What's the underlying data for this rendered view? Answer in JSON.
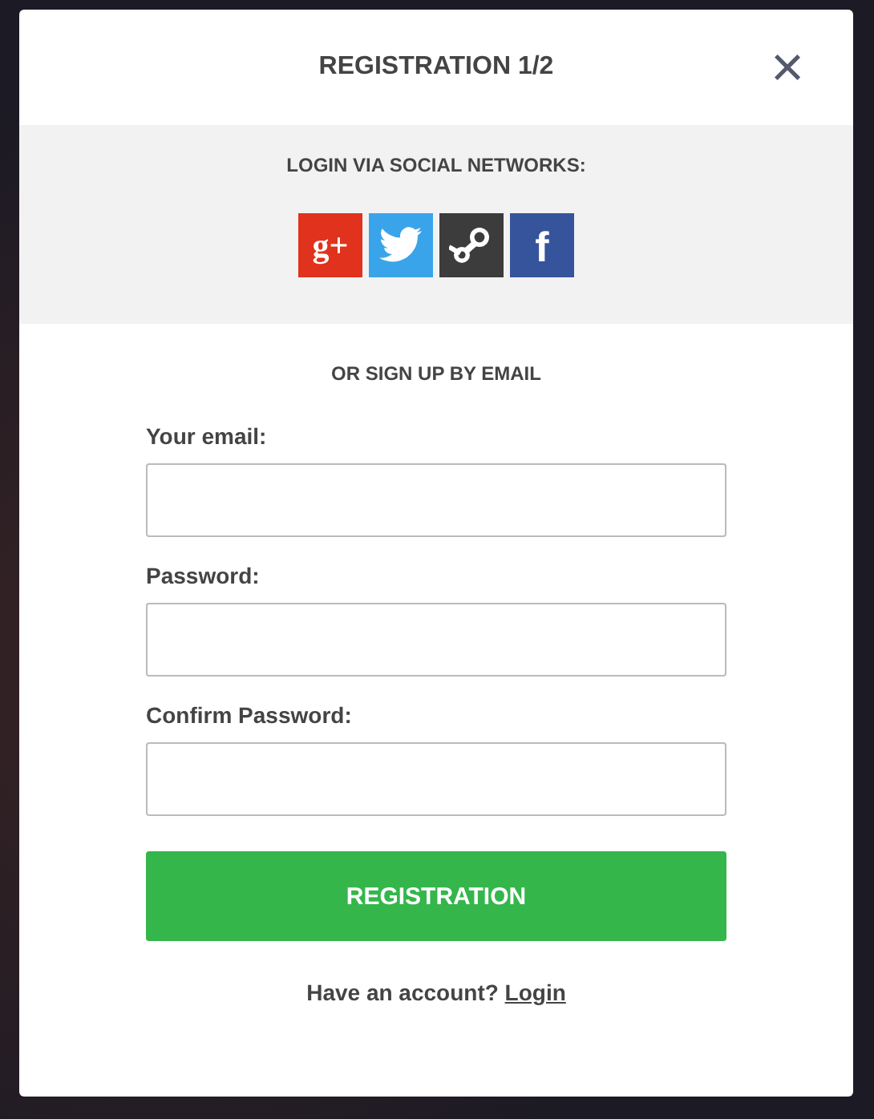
{
  "modal": {
    "title": "REGISTRATION 1/2",
    "close": "×"
  },
  "social": {
    "heading": "LOGIN VIA SOCIAL NETWORKS:",
    "buttons": [
      {
        "kind": "google",
        "label": "g+",
        "color": "#e0321c"
      },
      {
        "kind": "twitter",
        "color": "#3aa4ea"
      },
      {
        "kind": "steam",
        "color": "#3c3c3c"
      },
      {
        "kind": "facebook",
        "label": "f",
        "color": "#35549c"
      }
    ]
  },
  "email_heading": "OR SIGN UP BY EMAIL",
  "fields": [
    {
      "label": "Your email:"
    },
    {
      "label": "Password:"
    },
    {
      "label": "Confirm Password:"
    }
  ],
  "submit": "REGISTRATION",
  "footer": {
    "text": "Have an account?",
    "link": "Login"
  }
}
